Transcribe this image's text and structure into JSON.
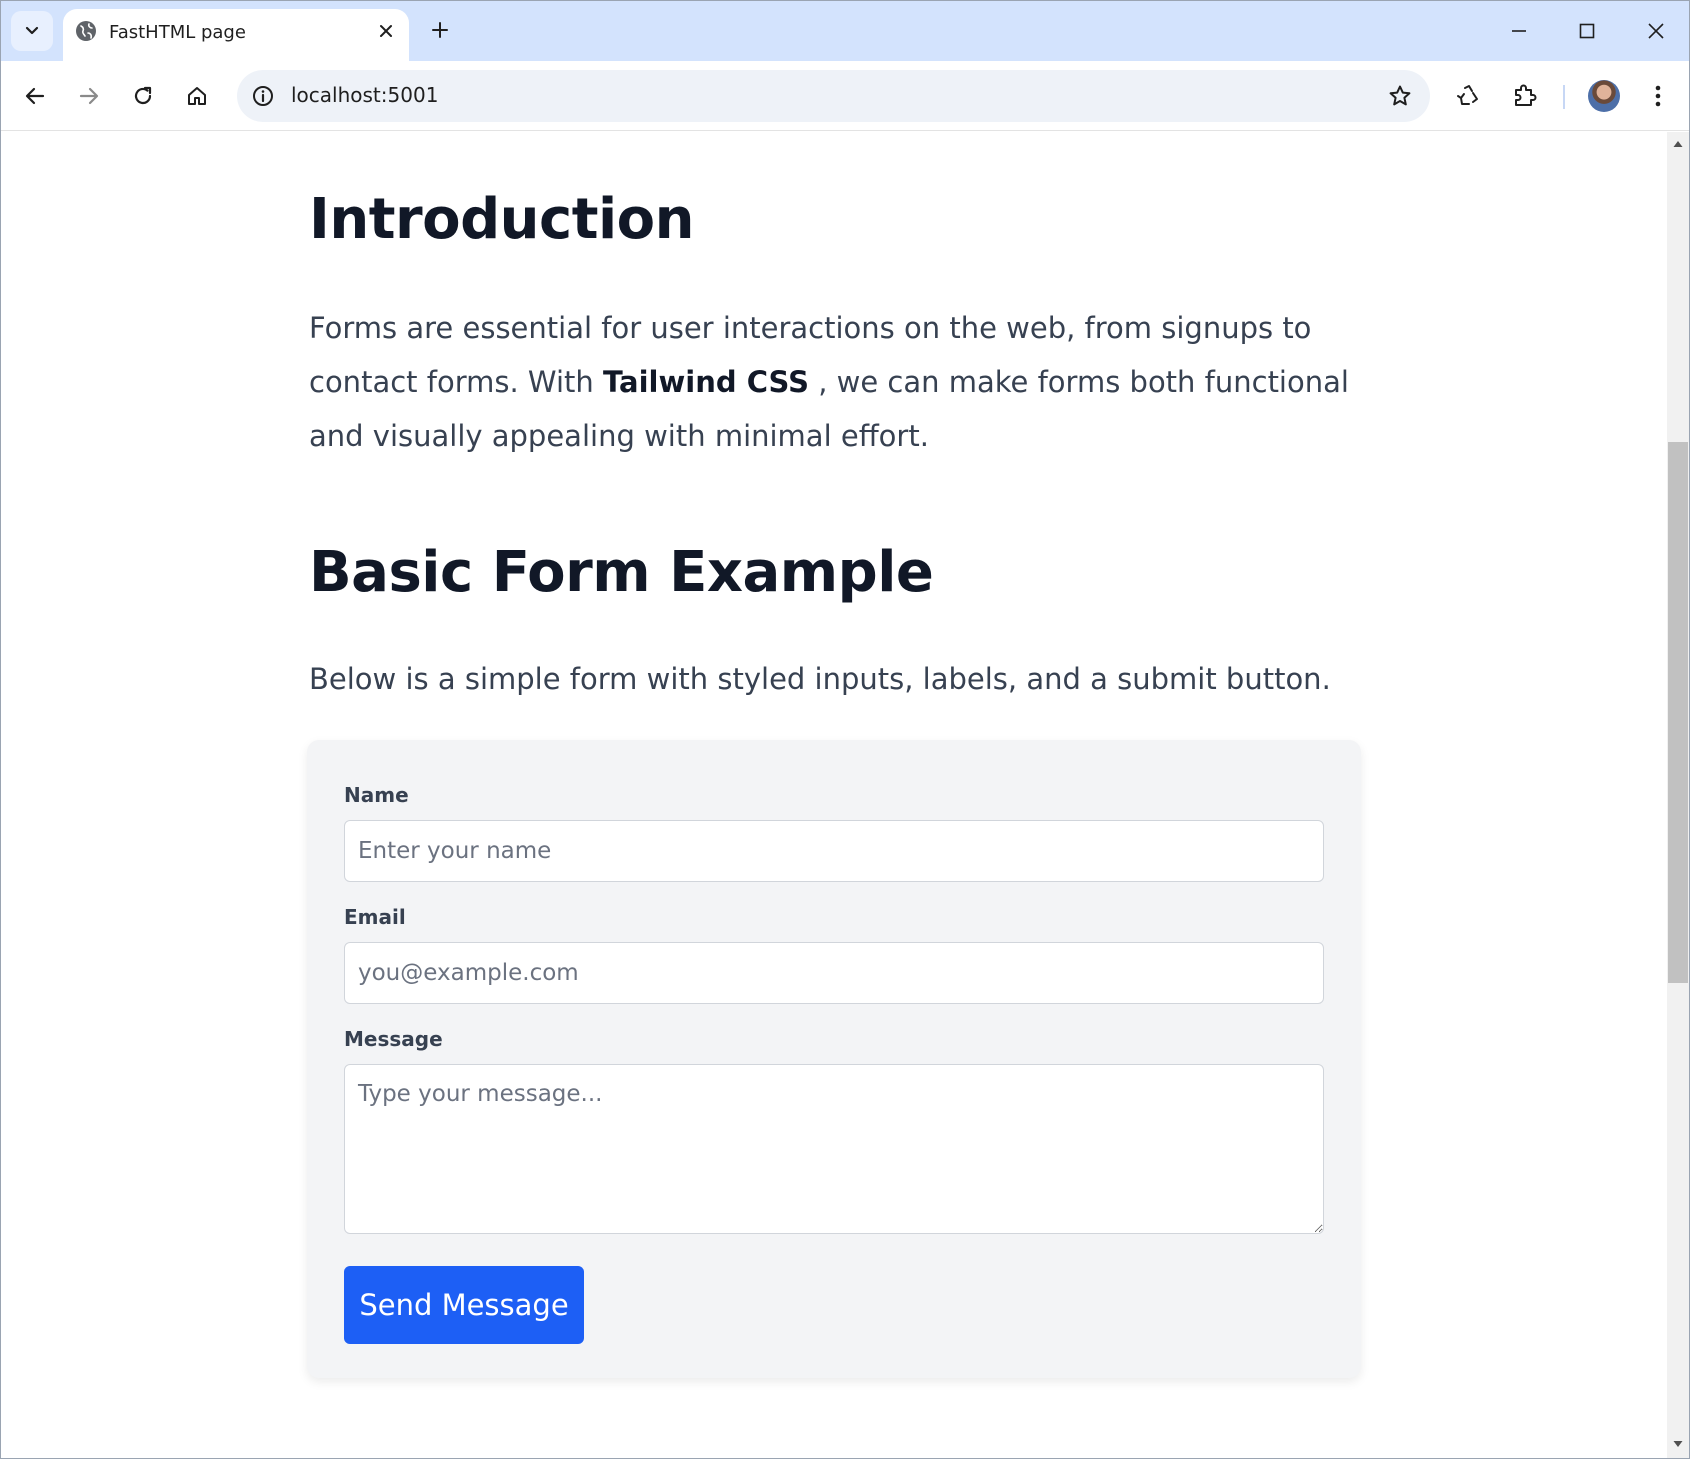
{
  "browser": {
    "tab_title": "FastHTML page",
    "url": "localhost:5001"
  },
  "page": {
    "intro_heading": "Introduction",
    "intro_text_before": "Forms are essential for user interactions on the web, from signups to contact forms. With ",
    "intro_text_bold": "Tailwind CSS",
    "intro_text_after": " , we can make forms both functional and visually appealing with minimal effort.",
    "basic_heading": "Basic Form Example",
    "basic_text": "Below is a simple form with styled inputs, labels, and a submit button."
  },
  "form": {
    "name_label": "Name",
    "name_placeholder": "Enter your name",
    "email_label": "Email",
    "email_placeholder": "you@example.com",
    "message_label": "Message",
    "message_placeholder": "Type your message...",
    "submit_label": "Send Message"
  },
  "colors": {
    "tabstrip_bg": "#d3e3fd",
    "heading": "#111827",
    "body_text": "#374151",
    "form_bg": "#f3f4f6",
    "button_bg": "#1d5ff5"
  },
  "icons": {
    "tab_search": "chevron-down-icon",
    "favicon": "globe-icon",
    "tab_close": "close-icon",
    "new_tab": "plus-icon",
    "minimize": "minimize-icon",
    "maximize": "maximize-icon",
    "close_window": "close-icon",
    "back": "arrow-left-icon",
    "forward": "arrow-right-icon",
    "reload": "reload-icon",
    "home": "home-icon",
    "site_info": "info-icon",
    "bookmark": "star-icon",
    "recycle": "recycle-icon",
    "extensions": "puzzle-icon",
    "menu": "more-vertical-icon"
  }
}
